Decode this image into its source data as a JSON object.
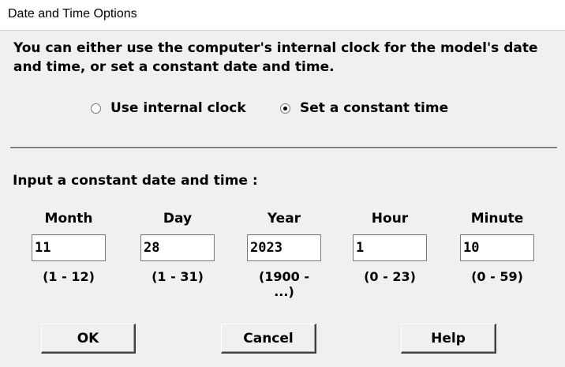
{
  "window": {
    "title": "Date and Time Options"
  },
  "intro": "You can either use the computer's internal clock for the model's date and time, or set a constant date and time.",
  "mode": {
    "options": [
      {
        "label": "Use internal clock",
        "selected": false
      },
      {
        "label": "Set a constant time",
        "selected": true
      }
    ]
  },
  "constant": {
    "section_label": "Input a constant date and time :",
    "fields": [
      {
        "label": "Month",
        "value": "11",
        "range": "(1 - 12)"
      },
      {
        "label": "Day",
        "value": "28",
        "range": "(1 - 31)"
      },
      {
        "label": "Year",
        "value": "2023",
        "range": "(1900 - ...)"
      },
      {
        "label": "Hour",
        "value": "1",
        "range": "(0 - 23)"
      },
      {
        "label": "Minute",
        "value": "10",
        "range": "(0 - 59)"
      }
    ]
  },
  "buttons": {
    "ok": "OK",
    "cancel": "Cancel",
    "help": "Help"
  }
}
